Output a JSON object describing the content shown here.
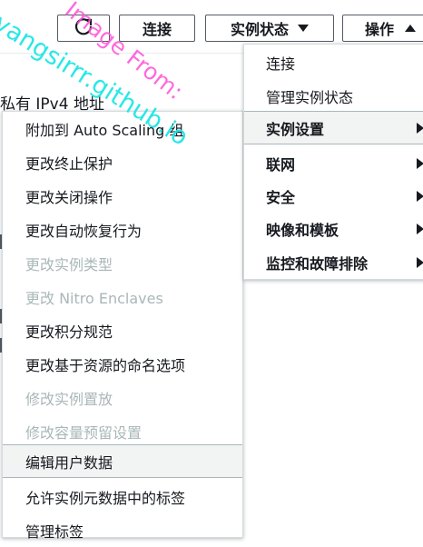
{
  "toolbar": {
    "connect": "连接",
    "instance_state": "实例状态",
    "actions": "操作"
  },
  "background": {
    "heading": "私有 IPv4 地址"
  },
  "submenu": {
    "items": [
      {
        "label": "附加到 Auto Scaling 组",
        "disabled": false
      },
      {
        "label": "更改终止保护",
        "disabled": false
      },
      {
        "label": "更改关闭操作",
        "disabled": false
      },
      {
        "label": "更改自动恢复行为",
        "disabled": false
      },
      {
        "label": "更改实例类型",
        "disabled": true
      },
      {
        "label": "更改 Nitro Enclaves",
        "disabled": true
      },
      {
        "label": "更改积分规范",
        "disabled": false
      },
      {
        "label": "更改基于资源的命名选项",
        "disabled": false
      },
      {
        "label": "修改实例置放",
        "disabled": true
      },
      {
        "label": "修改容量预留设置",
        "disabled": true
      },
      {
        "label": "编辑用户数据",
        "disabled": false
      },
      {
        "label": "允许实例元数据中的标签",
        "disabled": false
      },
      {
        "label": "管理标签",
        "disabled": false
      }
    ]
  },
  "actions_menu": {
    "items": [
      {
        "label": "连接",
        "has_submenu": false
      },
      {
        "label": "管理实例状态",
        "has_submenu": false
      },
      {
        "label": "实例设置",
        "has_submenu": true
      },
      {
        "label": "联网",
        "has_submenu": true
      },
      {
        "label": "安全",
        "has_submenu": true
      },
      {
        "label": "映像和模板",
        "has_submenu": true
      },
      {
        "label": "监控和故障排除",
        "has_submenu": true
      }
    ]
  },
  "watermark": {
    "line1": "yangsirrr.github.io",
    "line2": "Image From:"
  },
  "colors": {
    "menu_hover_bg": "#f2f3f3",
    "disabled_text": "#aab7b8",
    "watermark_cyan": "#19e6e6",
    "watermark_magenta": "#ff4fd8"
  },
  "icons": {
    "refresh": "refresh-icon",
    "instance_state_caret": "caret-down-icon",
    "actions_caret": "caret-up-icon",
    "submenu_arrow": "caret-right-icon"
  }
}
